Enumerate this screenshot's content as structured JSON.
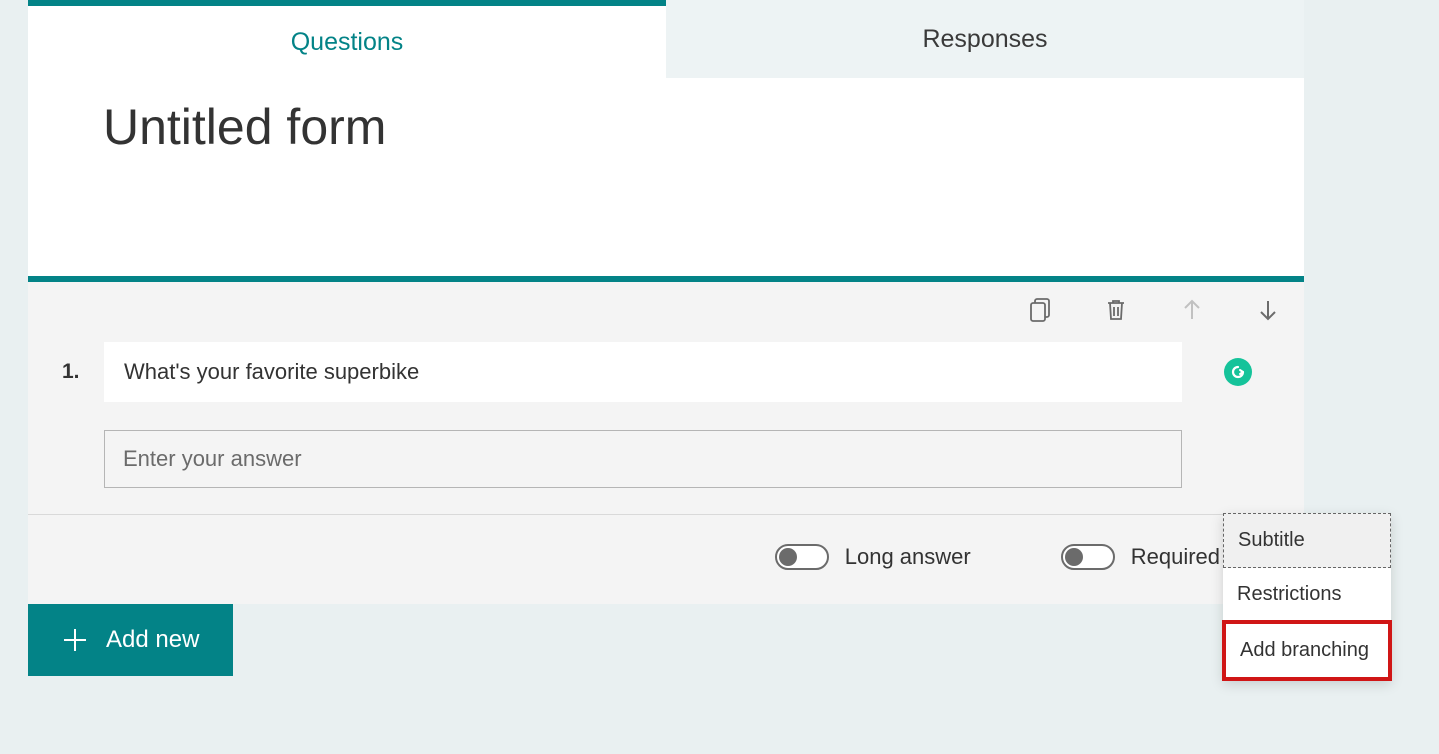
{
  "tabs": {
    "questions": "Questions",
    "responses": "Responses"
  },
  "form": {
    "title": "Untitled form"
  },
  "question": {
    "number": "1.",
    "text": "What's your favorite superbike",
    "answer_placeholder": "Enter your answer"
  },
  "options": {
    "long_answer_label": "Long answer",
    "required_label": "Required"
  },
  "menu": {
    "subtitle": "Subtitle",
    "restrictions": "Restrictions",
    "add_branching": "Add branching"
  },
  "actions": {
    "add_new": "Add new"
  },
  "icons": {
    "copy": "copy-icon",
    "delete": "delete-icon",
    "up": "arrow-up-icon",
    "down": "arrow-down-icon",
    "grammarly": "grammarly-icon",
    "plus": "plus-icon"
  }
}
